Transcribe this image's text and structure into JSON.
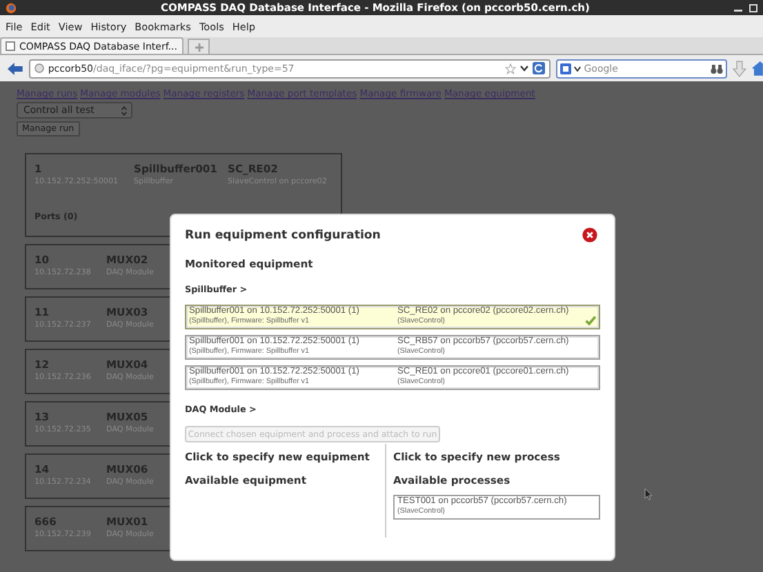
{
  "window": {
    "title": "COMPASS DAQ Database Interface - Mozilla Firefox (on pccorb50.cern.ch)"
  },
  "menu": [
    "File",
    "Edit",
    "View",
    "History",
    "Bookmarks",
    "Tools",
    "Help"
  ],
  "tabs": [
    {
      "label": "COMPASS DAQ Database Interf...",
      "selected": true
    }
  ],
  "address_bar": {
    "url": "**pccorb50**/daq_iface/?pg=equipment&run_type=57"
  },
  "search": {
    "placeholder": "Google"
  },
  "nav_links": [
    "Manage runs",
    "Manage modules",
    "Manage registers",
    "Manage port templates",
    "Manage firmware",
    "Manage equipment"
  ],
  "run_select": {
    "value": "Control all test"
  },
  "manage_run_button": "Manage run",
  "modules": [
    {
      "id": "1",
      "address": "10.152.72.252:50001",
      "name": "Spillbuffer001",
      "type": "Spillbuffer",
      "process": "SC_RE02",
      "process_host": "SlaveControl on pccore02",
      "ports": "Ports (0)"
    },
    {
      "id": "10",
      "address": "10.152.72.238",
      "name": "MUX02",
      "type": "DAQ Module"
    },
    {
      "id": "11",
      "address": "10.152.72.237",
      "name": "MUX03",
      "type": "DAQ Module"
    },
    {
      "id": "12",
      "address": "10.152.72.236",
      "name": "MUX04",
      "type": "DAQ Module"
    },
    {
      "id": "13",
      "address": "10.152.72.235",
      "name": "MUX05",
      "type": "DAQ Module"
    },
    {
      "id": "14",
      "address": "10.152.72.234",
      "name": "MUX06",
      "type": "DAQ Module"
    },
    {
      "id": "666",
      "address": "10.152.72.239",
      "name": "MUX01",
      "type": "DAQ Module"
    }
  ],
  "dialog": {
    "title": "Run equipment configuration",
    "section": "Monitored equipment",
    "groups": [
      {
        "label": "Spillbuffer >",
        "rows": [
          {
            "equipment": "Spillbuffer001 on 10.152.72.252:50001 (1)",
            "equipment_detail": "(Spillbuffer), Firmware: Spillbuffer v1",
            "process": "SC_RE02 on pccore02 (pccore02.cern.ch)",
            "process_detail": "(SlaveControl)",
            "selected": true
          },
          {
            "equipment": "Spillbuffer001 on 10.152.72.252:50001 (1)",
            "equipment_detail": "(Spillbuffer), Firmware: Spillbuffer v1",
            "process": "SC_RB57 on pccorb57 (pccorb57.cern.ch)",
            "process_detail": "(SlaveControl)",
            "selected": false
          },
          {
            "equipment": "Spillbuffer001 on 10.152.72.252:50001 (1)",
            "equipment_detail": "(Spillbuffer), Firmware: Spillbuffer v1",
            "process": "SC_RE01 on pccore01 (pccore01.cern.ch)",
            "process_detail": "(SlaveControl)",
            "selected": false
          }
        ]
      },
      {
        "label": "DAQ Module >"
      }
    ],
    "connect_button": {
      "label": "Connect chosen equipment and process and attach to run",
      "disabled": true
    },
    "new_equipment_link": "Click to specify new equipment",
    "available_equipment_heading": "Available equipment",
    "new_process_link": "Click to specify new process",
    "available_processes_heading": "Available processes",
    "available_processes": [
      {
        "process": "TEST001 on pccorb57 (pccorb57.cern.ch)",
        "detail": "(SlaveControl)"
      }
    ]
  }
}
